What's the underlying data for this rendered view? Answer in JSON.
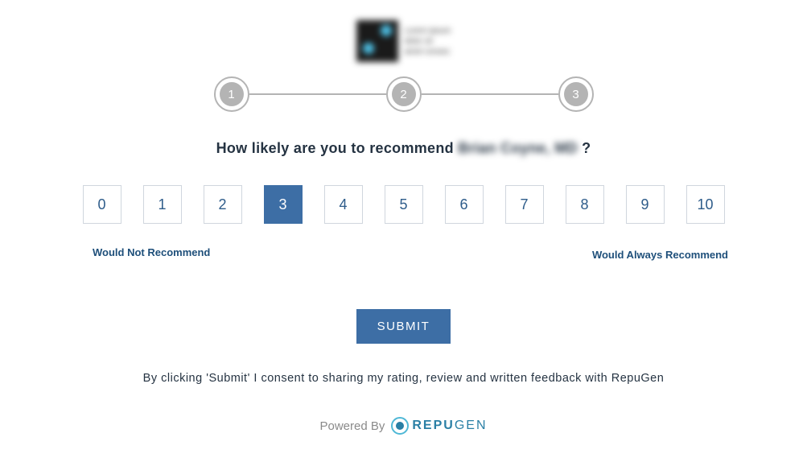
{
  "stepper": {
    "steps": [
      "1",
      "2",
      "3"
    ],
    "current": 1
  },
  "question": {
    "prefix": "How likely are you to recommend",
    "subject": "Brian Coyne, MD",
    "suffix": "?"
  },
  "rating": {
    "options": [
      "0",
      "1",
      "2",
      "3",
      "4",
      "5",
      "6",
      "7",
      "8",
      "9",
      "10"
    ],
    "selected": "3",
    "label_low": "Would Not Recommend",
    "label_high": "Would Always Recommend"
  },
  "submit_label": "SUBMIT",
  "consent_text": "By clicking 'Submit' I consent to sharing my rating, review and written feedback with RepuGen",
  "footer": {
    "powered_by": "Powered By",
    "brand_bold": "REPU",
    "brand_light": "GEN"
  }
}
